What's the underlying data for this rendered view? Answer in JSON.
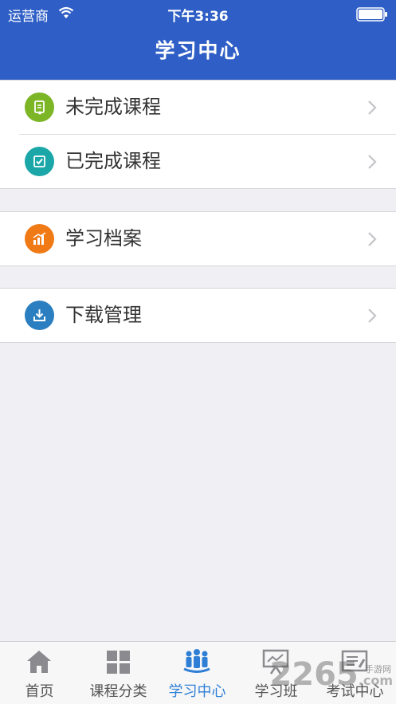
{
  "status_bar": {
    "carrier": "运营商",
    "time": "下午3:36"
  },
  "header": {
    "title": "学习中心"
  },
  "groups": [
    {
      "items": [
        {
          "label": "未完成课程",
          "icon": "unfinished-course-icon",
          "color": "#7cb526"
        },
        {
          "label": "已完成课程",
          "icon": "completed-course-icon",
          "color": "#1ba7a8"
        }
      ]
    },
    {
      "items": [
        {
          "label": "学习档案",
          "icon": "learning-record-icon",
          "color": "#f07a16"
        }
      ]
    },
    {
      "items": [
        {
          "label": "下载管理",
          "icon": "download-icon",
          "color": "#2b7fc0"
        }
      ]
    }
  ],
  "tabbar": {
    "tabs": [
      {
        "label": "首页",
        "icon": "home-icon",
        "active": false
      },
      {
        "label": "课程分类",
        "icon": "grid-icon",
        "active": false
      },
      {
        "label": "学习中心",
        "icon": "people-icon",
        "active": true
      },
      {
        "label": "学习班",
        "icon": "classroom-icon",
        "active": false
      },
      {
        "label": "考试中心",
        "icon": "exam-icon",
        "active": false
      }
    ]
  },
  "watermark": {
    "main": "2265",
    "sub": "手游网",
    "suffix": ".com"
  },
  "colors": {
    "header": "#2f5fc6",
    "active_tab": "#2f7fd6"
  }
}
